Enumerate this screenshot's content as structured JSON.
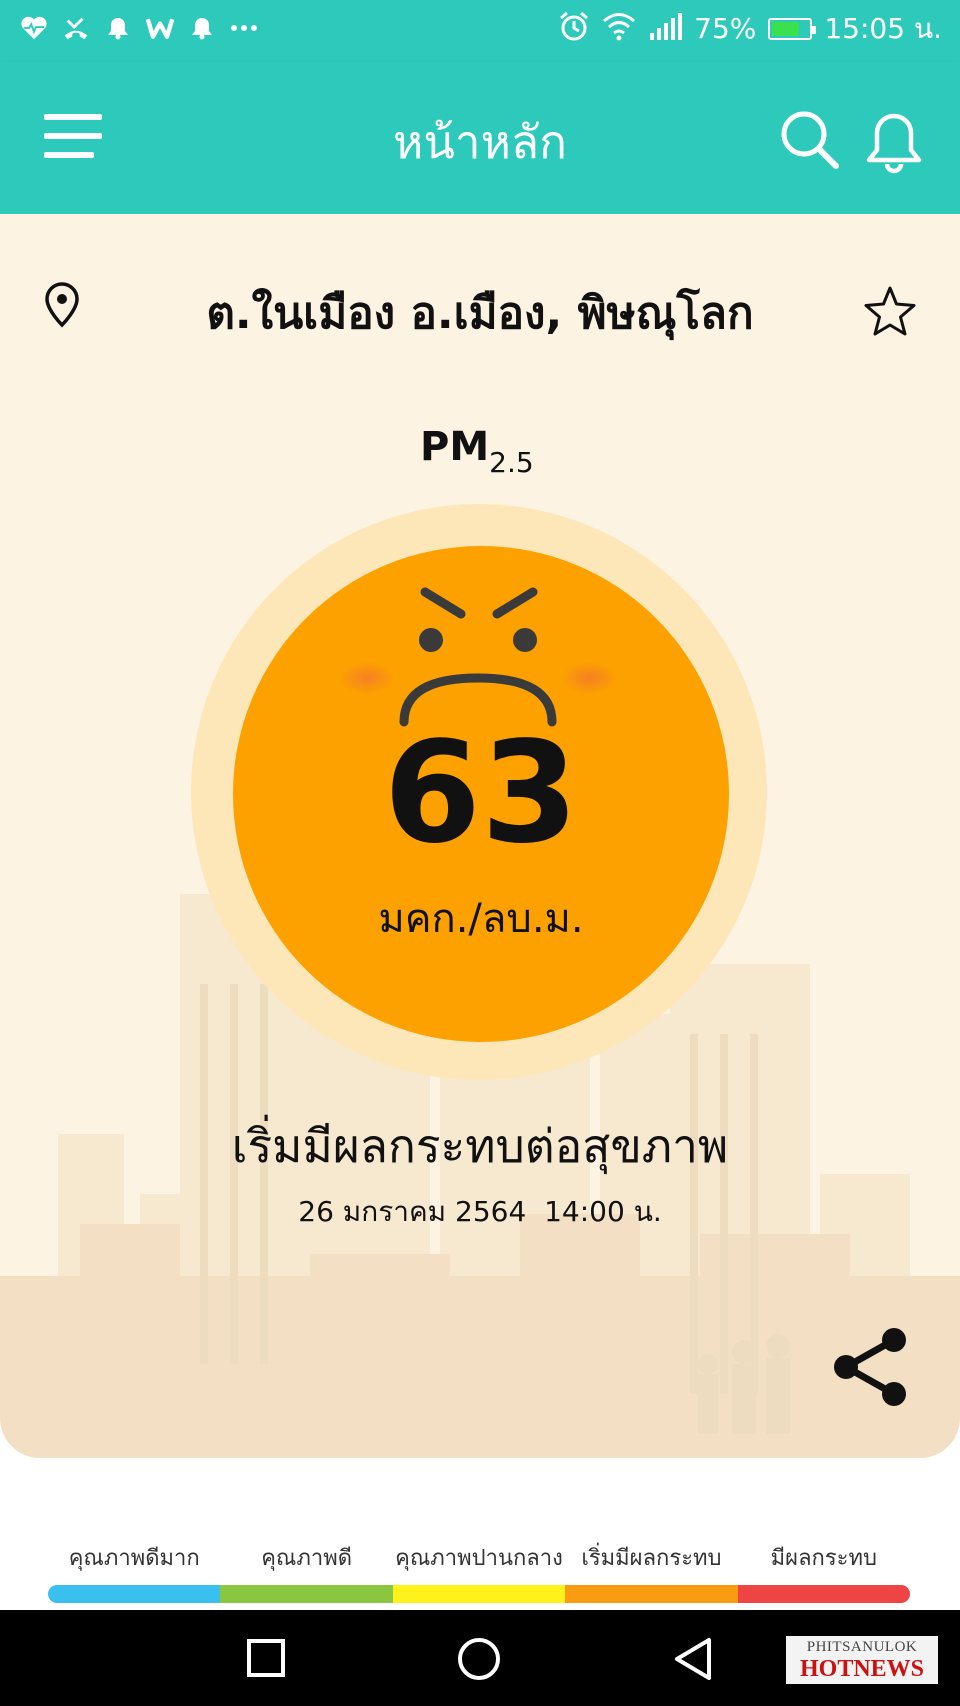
{
  "status_bar": {
    "icons_left": [
      "heart-pulse-icon",
      "missed-call-icon",
      "notification-bell-icon",
      "w-app-icon",
      "notification-bell-icon",
      "more-icon"
    ],
    "icons_right": [
      "alarm-icon",
      "wifi-icon",
      "signal-icon",
      "battery-charging-icon"
    ],
    "battery": "75%",
    "battery_level": 0.75,
    "time": "15:05 น."
  },
  "app_bar": {
    "title": "หน้าหลัก",
    "menu_icon": "hamburger-menu-icon",
    "search_icon": "search-icon",
    "bell_icon": "bell-icon",
    "background": "#2dcabb"
  },
  "location": {
    "name": "ต.ในเมือง อ.เมือง, พิษณุโลก",
    "pin_icon": "location-pin-icon",
    "favorite_icon": "star-outline-icon"
  },
  "reading": {
    "pollutant": "PM",
    "pollutant_sub": "2.5",
    "value": "63",
    "unit": "มคก./ลบ.ม.",
    "face_icon": "angry-face-icon",
    "color": "#fca100",
    "status": "เริ่มมีผลกระทบต่อสุขภาพ",
    "timestamp": "26 มกราคม 2564  14:00 น."
  },
  "share": {
    "icon": "share-icon"
  },
  "legend": {
    "items": [
      {
        "label": "คุณภาพดีมาก",
        "color": "#3bbfee"
      },
      {
        "label": "คุณภาพดี",
        "color": "#8ac640"
      },
      {
        "label": "คุณภาพปานกลาง",
        "color": "#fff21a"
      },
      {
        "label": "เริ่มมีผลกระทบ",
        "color": "#fa9c12"
      },
      {
        "label": "มีผลกระทบ",
        "color": "#ee4444"
      }
    ]
  },
  "nav_bar": {
    "buttons": [
      "recents-square-icon",
      "home-circle-icon",
      "back-triangle-icon"
    ]
  },
  "watermark": {
    "top": "PHITSANULOK",
    "bottom": "HOTNEWS"
  }
}
